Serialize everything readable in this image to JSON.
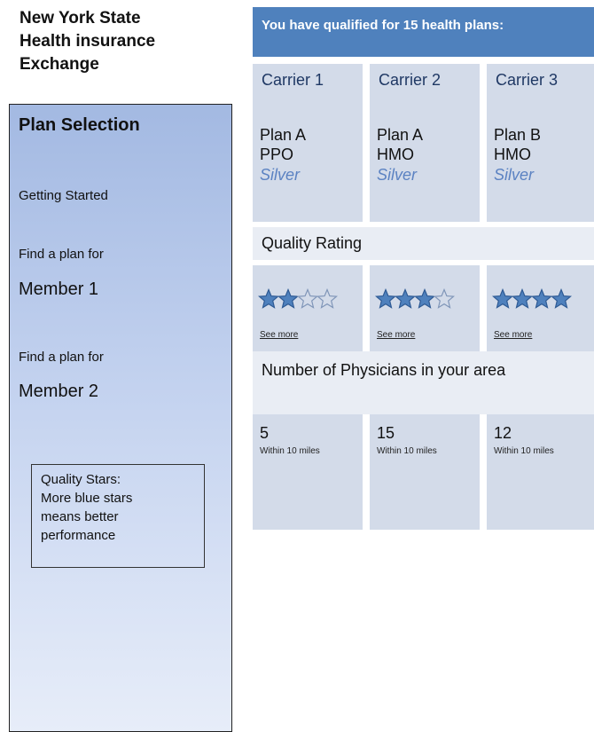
{
  "logo": {
    "lines": [
      "New York State",
      "Health insurance",
      "Exchange"
    ]
  },
  "sidebar": {
    "title": "Plan Selection",
    "getting_started": "Getting Started",
    "find_plan_1": "Find a plan for",
    "member_1": "Member 1",
    "find_plan_2": "Find a plan for",
    "member_2": "Member 2",
    "note_lines": [
      "Quality Stars:",
      "More blue stars",
      "means better",
      "performance"
    ]
  },
  "banner": {
    "text": "You have qualified for 15 health plans:"
  },
  "plans": [
    {
      "carrier": "Carrier 1",
      "plan": "Plan A",
      "type": "PPO",
      "metal": "Silver",
      "stars": 2,
      "see_more": "See more",
      "physicians": "5",
      "within": "Within 10 miles"
    },
    {
      "carrier": "Carrier 2",
      "plan": "Plan A",
      "type": "HMO",
      "metal": "Silver",
      "stars": 3,
      "see_more": "See more",
      "physicians": "15",
      "within": "Within 10 miles"
    },
    {
      "carrier": "Carrier 3",
      "plan": "Plan B",
      "type": "HMO",
      "metal": "Silver",
      "stars": 4,
      "see_more": "See more",
      "physicians": "12",
      "within": "Within 10 miles"
    }
  ],
  "stars_max": 4,
  "sections": {
    "quality_rating": "Quality Rating",
    "physicians": "Number of Physicians in your area"
  },
  "colors": {
    "banner": "#4f81bd",
    "star_fill": "#4f81bd",
    "metal_text": "#5b82c2"
  }
}
